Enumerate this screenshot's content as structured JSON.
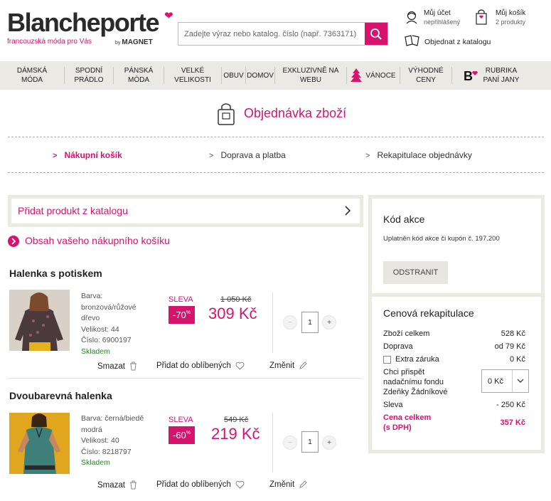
{
  "brand": {
    "name": "Blancheporte",
    "tagline": "francouzská móda pro Vás",
    "by": "by",
    "partner": "MAGNET",
    "accent": "#d6136d"
  },
  "search": {
    "placeholder": "Zadejte výraz nebo katalog. číslo (např. 7363171)"
  },
  "account": {
    "label": "Můj účet",
    "status": "nepřihlášený"
  },
  "cart_link": {
    "label": "Můj košík",
    "count": "2 produkty"
  },
  "catalog_order": {
    "label": "Objednat z katalogu"
  },
  "nav": {
    "items": [
      {
        "line1": "Dámská",
        "line2": "móda"
      },
      {
        "line1": "Spodní",
        "line2": "prádlo"
      },
      {
        "line1": "Pánská",
        "line2": "móda"
      },
      {
        "line1": "Velké",
        "line2": "velikosti"
      },
      {
        "line1": "Obuv",
        "line2": ""
      },
      {
        "line1": "Domov",
        "line2": ""
      },
      {
        "line1": "Exkluzivně na",
        "line2": "webu"
      },
      {
        "line1": "Vánoce",
        "line2": ""
      },
      {
        "line1": "Výhodné",
        "line2": "ceny"
      },
      {
        "line1": "Rubrika",
        "line2": "paní Jany"
      }
    ]
  },
  "page_title": "Objednávka zboží",
  "steps": {
    "chevron": ">",
    "cart": "Nákupní košík",
    "shipping": "Doprava a platba",
    "summary": "Rekapitulace objednávky"
  },
  "add_from_catalog": "Přidat produkt z katalogu",
  "cart_heading": "Obsah vašeho nákupního košíku",
  "labels": {
    "color": "Barva:",
    "size": "Velikost:",
    "number": "Číslo:",
    "sale": "SLEVA",
    "delete": "Smazat",
    "favorite": "Přidat do oblíbených",
    "change": "Změnit"
  },
  "products": [
    {
      "name": "Halenka s potiskem",
      "color_line1": "bronzová/růžové",
      "color_line2": "dřevo",
      "size": "44",
      "number": "6900197",
      "stock": "Skladem",
      "discount": "-70",
      "discount_unit": "%",
      "old_price": "1 050 Kč",
      "price": "309 Kč",
      "qty": "1",
      "image_color": "#4a3a3c"
    },
    {
      "name": "Dvoubarevná halenka",
      "color_line1": "černá/biedě",
      "color_line2": "modrá",
      "size": "40",
      "number": "8218797",
      "stock": "Skladem",
      "discount": "-60",
      "discount_unit": "%",
      "old_price": "549 Kč",
      "price": "219 Kč",
      "qty": "1",
      "image_color": "#3f7f7a"
    }
  ],
  "promo": {
    "title": "Kód akce",
    "subtitle": "Uplatněn kód akce či kupón č. 197.200",
    "remove": "ODSTRANIT"
  },
  "summary": {
    "title": "Cenová rekapitulace",
    "goods_label": "Zboží celkem",
    "goods_value": "528 Kč",
    "shipping_label": "Doprava",
    "shipping_value": "od 79 Kč",
    "warranty_label": "Extra záruka",
    "warranty_value": "0 Kč",
    "donate_line1": "Chci přispět",
    "donate_line2": "nadačnímu fondu",
    "donate_line3": "Zdeňky Žádníkové",
    "donate_value": "0 Kč",
    "discount_label": "Sleva",
    "discount_value": "- 250 Kč",
    "total_line1": "Cena celkem",
    "total_line2": "(s DPH)",
    "total_value": "357 Kč"
  }
}
